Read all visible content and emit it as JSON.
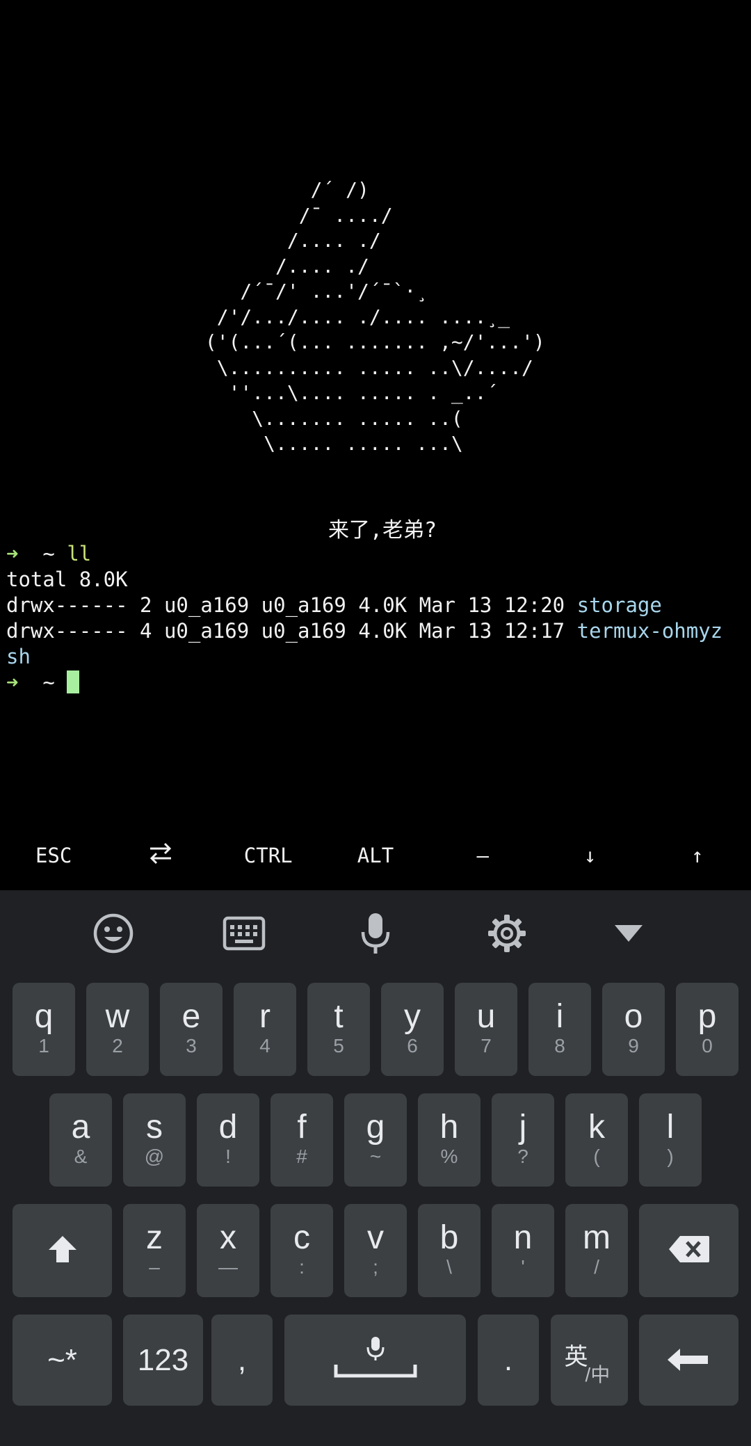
{
  "terminal": {
    "ascii_art": "          /´ /)\n         /¯ ..../\n        /.... ./\n       /.... ./\n    /´¯/' ...'/´¯`·¸\n  /'/.../.... ./.... ....¸_\n ('(...´(... ....... ,~/'...')\n  \\.......... ..... ..\\/..../\n   ''...\\.... ..... . _..´\n     \\....... ..... ..(\n      \\..... ..... ...\\",
    "greeting": "来了,老弟?",
    "prompt_arrow": "➜",
    "prompt_dir": "~",
    "command": "ll",
    "total_line": "total 8.0K",
    "entries": [
      {
        "meta": "drwx------ 2 u0_a169 u0_a169 4.0K Mar 13 12:20 ",
        "name": "storage"
      },
      {
        "meta": "drwx------ 4 u0_a169 u0_a169 4.0K Mar 13 12:17 ",
        "name": "termux-ohmyz",
        "name_wrap": "sh"
      }
    ]
  },
  "extra_keys": [
    {
      "label": "ESC",
      "icon": ""
    },
    {
      "label": "",
      "icon": "tab-arrows-icon"
    },
    {
      "label": "CTRL",
      "icon": ""
    },
    {
      "label": "ALT",
      "icon": ""
    },
    {
      "label": "—",
      "icon": ""
    },
    {
      "label": "↓",
      "icon": ""
    },
    {
      "label": "↑",
      "icon": ""
    }
  ],
  "keyboard": {
    "toolbar_icons": [
      "emoji-icon",
      "keyboard-icon",
      "microphone-icon",
      "settings-gear-icon",
      "collapse-triangle-icon"
    ],
    "row1": [
      {
        "main": "q",
        "sub": "1"
      },
      {
        "main": "w",
        "sub": "2"
      },
      {
        "main": "e",
        "sub": "3"
      },
      {
        "main": "r",
        "sub": "4"
      },
      {
        "main": "t",
        "sub": "5"
      },
      {
        "main": "y",
        "sub": "6"
      },
      {
        "main": "u",
        "sub": "7"
      },
      {
        "main": "i",
        "sub": "8"
      },
      {
        "main": "o",
        "sub": "9"
      },
      {
        "main": "p",
        "sub": "0"
      }
    ],
    "row2": [
      {
        "main": "a",
        "sub": "&"
      },
      {
        "main": "s",
        "sub": "@"
      },
      {
        "main": "d",
        "sub": "!"
      },
      {
        "main": "f",
        "sub": "#"
      },
      {
        "main": "g",
        "sub": "~"
      },
      {
        "main": "h",
        "sub": "%"
      },
      {
        "main": "j",
        "sub": "?"
      },
      {
        "main": "k",
        "sub": "("
      },
      {
        "main": "l",
        "sub": ")"
      }
    ],
    "row3": [
      {
        "main": "z",
        "sub": "–"
      },
      {
        "main": "x",
        "sub": "—"
      },
      {
        "main": "c",
        "sub": ":"
      },
      {
        "main": "v",
        "sub": ";"
      },
      {
        "main": "b",
        "sub": "\\"
      },
      {
        "main": "n",
        "sub": "'"
      },
      {
        "main": "m",
        "sub": "/"
      }
    ],
    "symbols_label": "~*",
    "numbers_label": "123",
    "comma_label": ",",
    "period_label": ".",
    "lang_main": "英",
    "lang_sub": "/中"
  },
  "colors": {
    "terminal_bg": "#000000",
    "keyboard_bg": "#202124",
    "key_bg": "#3c4043",
    "prompt_green": "#a8e37a",
    "dir_blue": "#a9d6ec",
    "cursor": "#a8f0a0"
  }
}
